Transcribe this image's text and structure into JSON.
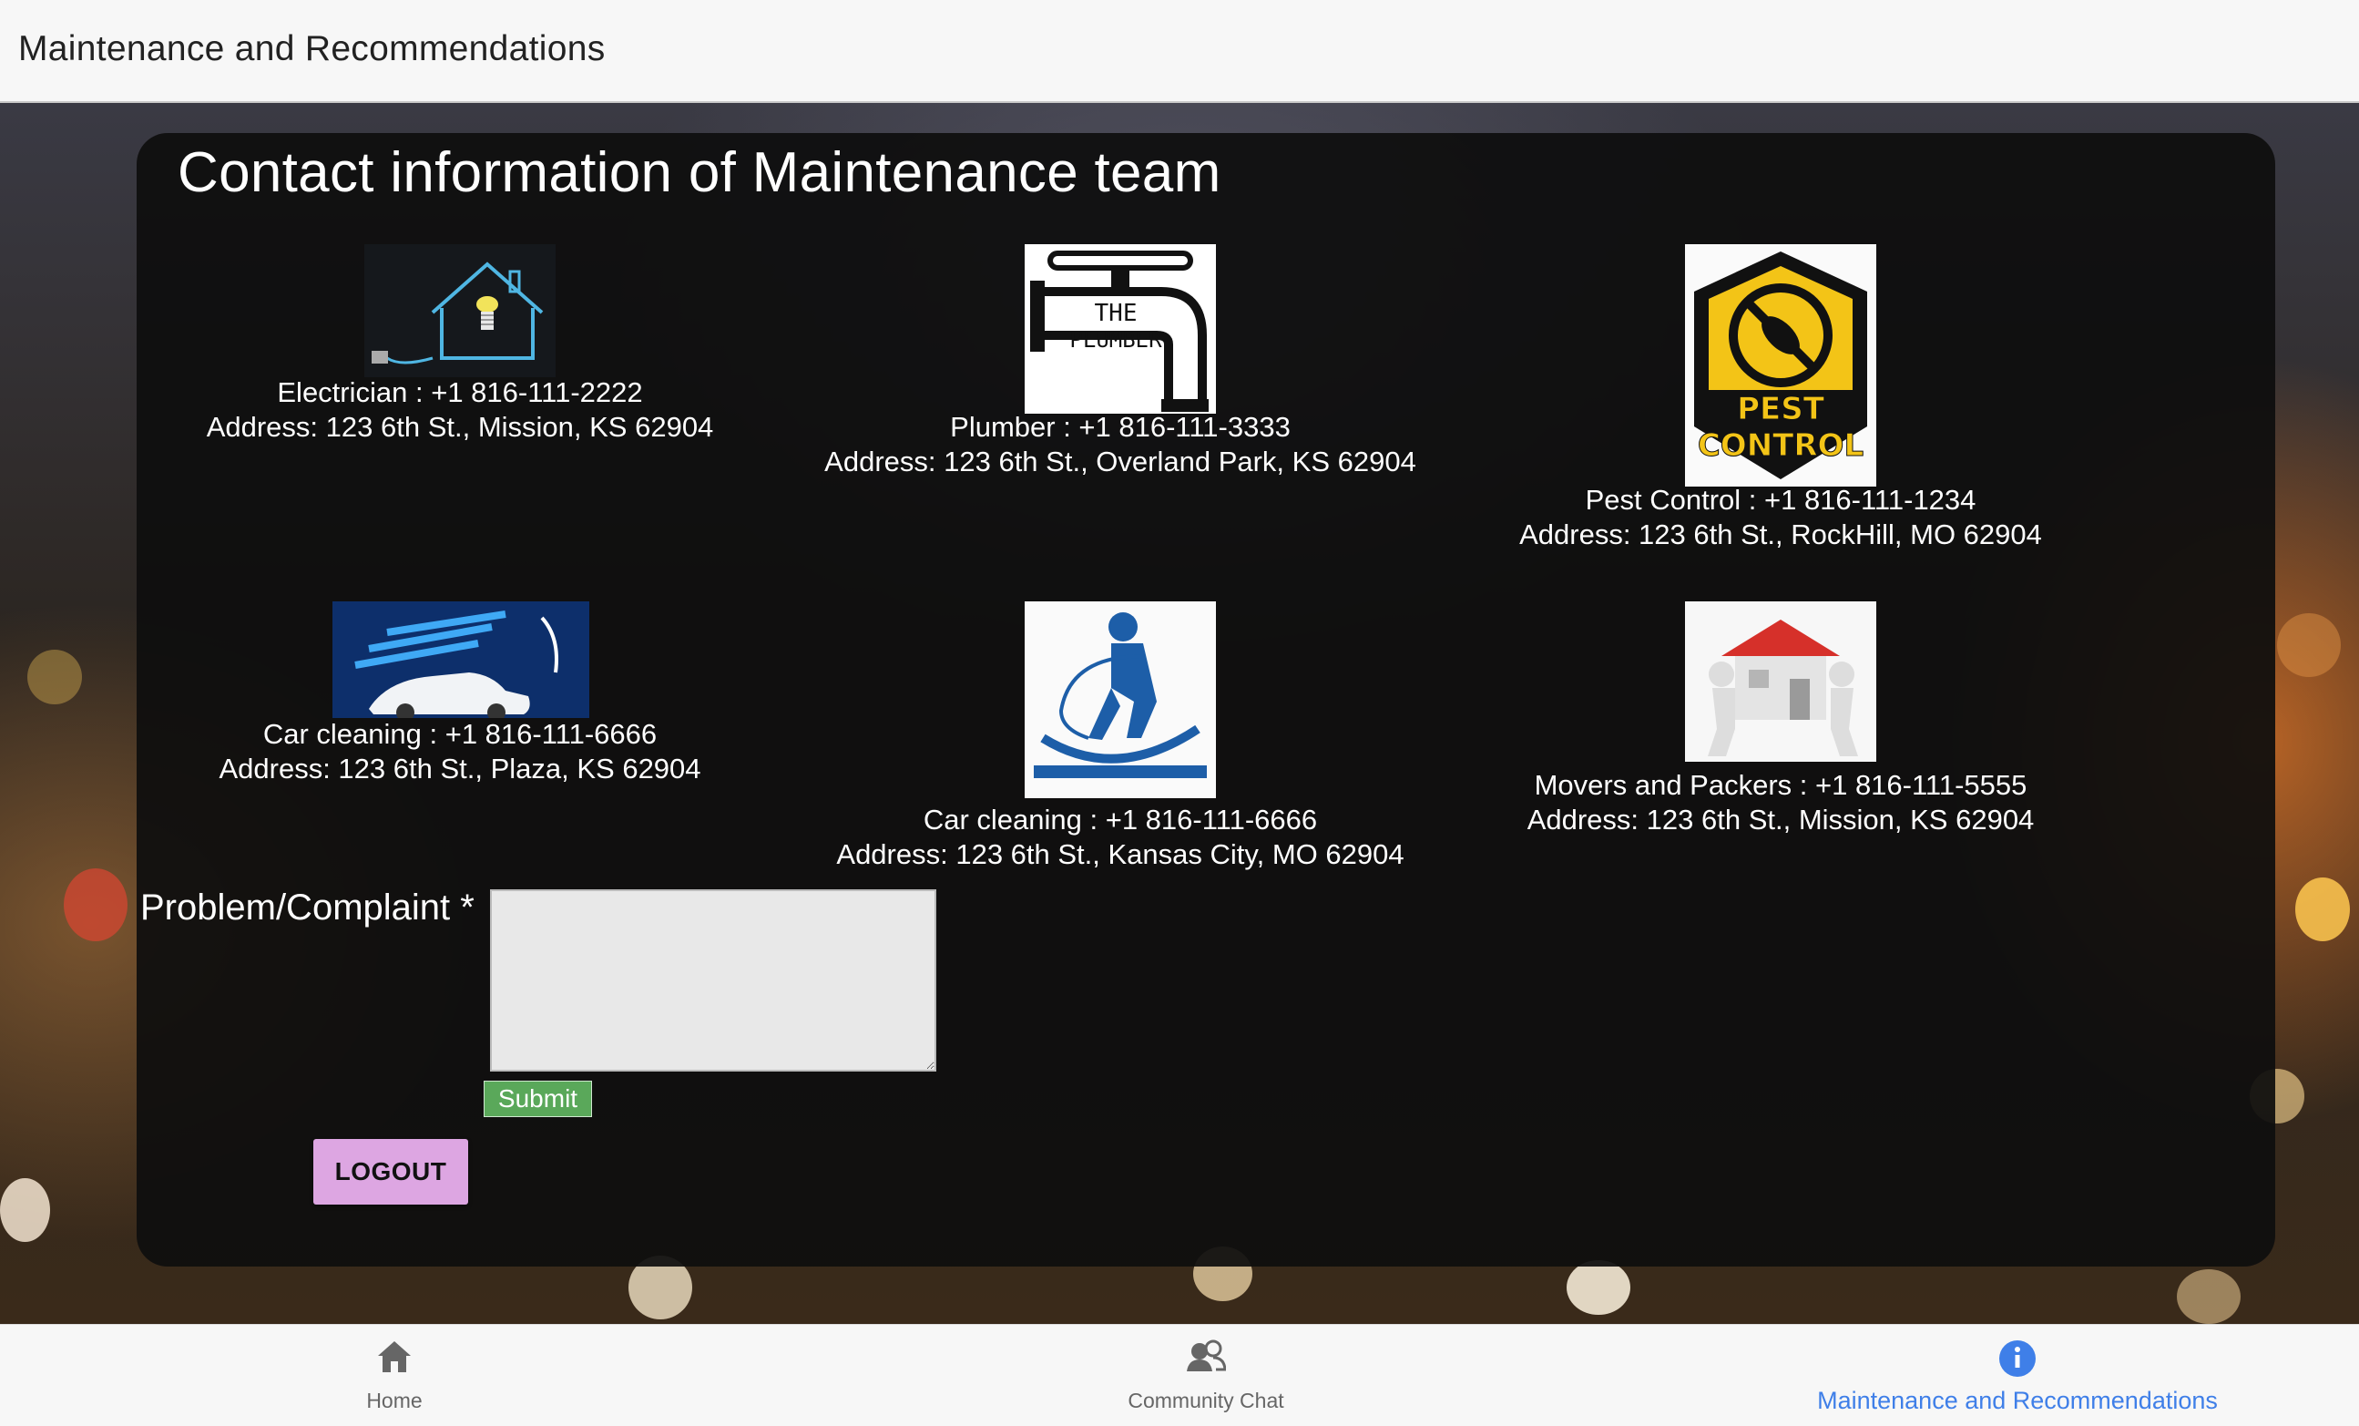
{
  "appbar": {
    "title": "Maintenance and Recommendations"
  },
  "card": {
    "title": "Contact information of Maintenance team"
  },
  "contacts": [
    {
      "name_phone": "Electrician : +1 816-111-2222",
      "address": "Address: 123 6th St., Mission, KS 62904",
      "icon": "electrician-house-bulb-image"
    },
    {
      "name_phone": "Plumber : +1 816-111-3333",
      "address": "Address: 123 6th St., Overland Park, KS 62904",
      "icon": "the-plumber-faucet-logo",
      "logo_text_1": "THE",
      "logo_text_2": "PLUMBER"
    },
    {
      "name_phone": "Pest Control : +1 816-111-1234",
      "address": "Address: 123 6th St., RockHill, MO 62904",
      "icon": "pest-control-logo",
      "logo_text_1": "PEST",
      "logo_text_2": "CONTROL"
    },
    {
      "name_phone": "Car cleaning : +1 816-111-6666",
      "address": "Address: 123 6th St., Plaza, KS 62904",
      "icon": "car-wash-image"
    },
    {
      "name_phone": "Car cleaning : +1 816-111-6666",
      "address": "Address: 123 6th St., Kansas City, MO 62904",
      "icon": "floor-cleaning-person-image"
    },
    {
      "name_phone": "Movers and Packers : +1 816-111-5555",
      "address": "Address: 123 6th St., Mission, KS 62904",
      "icon": "movers-carrying-house-image"
    }
  ],
  "form": {
    "label": "Problem/Complaint *",
    "complaint_value": "",
    "submit_label": "Submit"
  },
  "logout_label": "LOGOUT",
  "bottom_nav": {
    "items": [
      {
        "label": "Home",
        "icon": "home-icon"
      },
      {
        "label": "Community Chat",
        "icon": "community-chat-icon"
      },
      {
        "label": "Maintenance and Recommendations",
        "icon": "info-icon",
        "active": true
      }
    ]
  },
  "colors": {
    "accent": "#3f7fe8",
    "submit": "#5aa85a",
    "logout": "#dda6e2",
    "card": "#0e0e0e"
  }
}
